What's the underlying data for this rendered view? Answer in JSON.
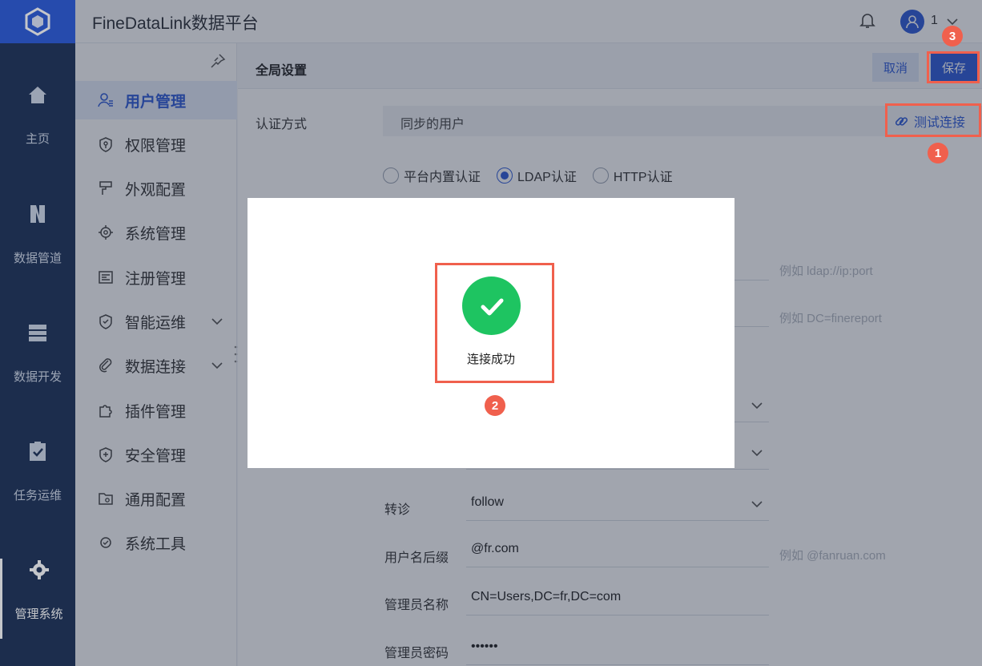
{
  "app": {
    "title": "FineDataLink数据平台",
    "user_name": "1"
  },
  "rail": {
    "items": [
      {
        "label": "主页",
        "icon": "home-icon"
      },
      {
        "label": "数据管道",
        "icon": "pipeline-icon"
      },
      {
        "label": "数据开发",
        "icon": "dev-icon"
      },
      {
        "label": "任务运维",
        "icon": "task-icon"
      },
      {
        "label": "管理系统",
        "icon": "gear-icon",
        "active": true
      }
    ]
  },
  "sidebar": {
    "items": [
      {
        "label": "用户管理",
        "icon": "user-icon",
        "active": true
      },
      {
        "label": "权限管理",
        "icon": "shield-key-icon"
      },
      {
        "label": "外观配置",
        "icon": "brush-icon"
      },
      {
        "label": "系统管理",
        "icon": "cog-icon"
      },
      {
        "label": "注册管理",
        "icon": "register-icon"
      },
      {
        "label": "智能运维",
        "icon": "ops-icon",
        "expandable": true
      },
      {
        "label": "数据连接",
        "icon": "link-icon",
        "expandable": true
      },
      {
        "label": "插件管理",
        "icon": "puzzle-icon"
      },
      {
        "label": "安全管理",
        "icon": "shield-icon"
      },
      {
        "label": "通用配置",
        "icon": "folder-gear-icon"
      },
      {
        "label": "系统工具",
        "icon": "tool-icon"
      }
    ]
  },
  "main": {
    "section_title": "全局设置",
    "cancel_label": "取消",
    "save_label": "保存",
    "auth_label": "认证方式",
    "auth_value": "同步的用户",
    "test_connection_label": "测试连接",
    "radio_options": [
      {
        "label": "平台内置认证",
        "checked": false
      },
      {
        "label": "LDAP认证",
        "checked": true
      },
      {
        "label": "HTTP认证",
        "checked": false
      }
    ],
    "hints": {
      "url": "例如  ldap://ip:port",
      "base_dn": "例如  DC=finereport",
      "suffix": "例如  @fanruan.com"
    },
    "fields": {
      "referral_label": "转诊",
      "referral_value": "follow",
      "suffix_label": "用户名后缀",
      "suffix_value": "@fr.com",
      "admin_name_label": "管理员名称",
      "admin_name_value": "CN=Users,DC=fr,DC=com",
      "admin_pwd_label": "管理员密码",
      "admin_pwd_value": "••••••"
    }
  },
  "dialog": {
    "message": "连接成功"
  },
  "annotations": {
    "badge1": "1",
    "badge2": "2",
    "badge3": "3"
  },
  "colors": {
    "brand": "#2d5bd8",
    "rail": "#1f3358",
    "success": "#1ec461",
    "annotation": "#f0604d"
  }
}
